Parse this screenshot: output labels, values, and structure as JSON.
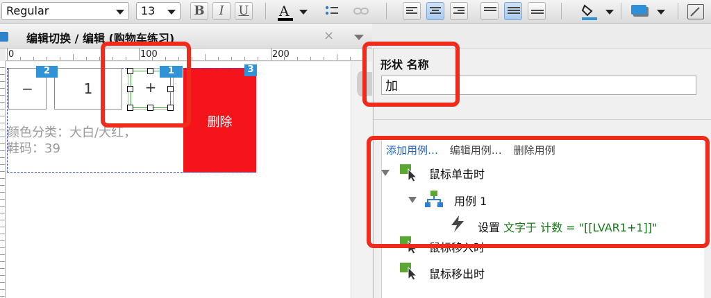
{
  "toolbar": {
    "font_style": "Regular",
    "font_size": "13",
    "bold_label": "B",
    "italic_label": "I",
    "underline_label": "U",
    "font_color_label": "A"
  },
  "tab": {
    "title": "编辑切换 / 编辑 (购物车练习)",
    "close_label": "×"
  },
  "ruler": {
    "marks": [
      "0",
      "100",
      "200"
    ]
  },
  "canvas": {
    "minus_label": "−",
    "quantity_value": "1",
    "plus_label": "+",
    "delete_label": "删除",
    "product_line1": "颜色分类：大白/大红，",
    "product_line2": "鞋码：39",
    "badges": [
      "2",
      "1",
      "3"
    ]
  },
  "panel": {
    "shape_name_label": "形状 名称",
    "shape_name_value": "加",
    "case_links": {
      "add": "添加用例…",
      "edit": "编辑用例…",
      "delete": "删除用例"
    },
    "events": {
      "on_click": "鼠标单击时",
      "case_1": "用例 1",
      "action_prefix": "设置",
      "action_detail": "文字于 计数 = \"[[LVAR1+1]]\"",
      "mouse_enter": "鼠标移入时",
      "mouse_leave": "鼠标移出时"
    }
  },
  "colors": {
    "highlight": "#ef2b1c",
    "delete_bg": "#f5141b",
    "badge": "#2f93d6",
    "link": "#1f5fbf",
    "action_text": "#137a13",
    "event_icon_green": "#5aa832"
  }
}
